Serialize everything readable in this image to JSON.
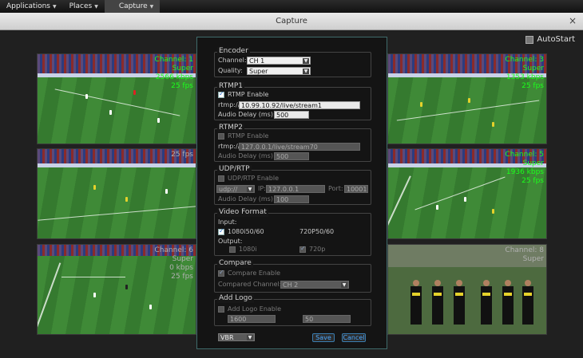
{
  "topbar": {
    "applications": "Applications",
    "places": "Places",
    "capture": "Capture"
  },
  "window": {
    "title": "Capture",
    "close": "×"
  },
  "autostart": {
    "label": "AutoStart"
  },
  "tiles": [
    {
      "lines": [
        "Channel: 1",
        "Super",
        "2566 kbps",
        "25 fps"
      ]
    },
    {
      "lines": [
        "Channel: 3",
        "Super",
        "1353 kbps",
        "25 fps"
      ]
    },
    {
      "lines": [
        "",
        "",
        "",
        "25 fps"
      ]
    },
    {
      "lines": [
        "Channel: 5",
        "Super",
        "1936 kbps",
        "25 fps"
      ]
    },
    {
      "lines": [
        "Channel: 6",
        "Super",
        "0 kbps",
        "25 fps"
      ]
    },
    {
      "lines": [
        "Channel: 8",
        "Super",
        "",
        ""
      ]
    }
  ],
  "dialog": {
    "encoder": {
      "title": "Encoder",
      "channel_label": "Channel:",
      "channel_value": "CH 1",
      "quality_label": "Quality:",
      "quality_value": "Super"
    },
    "rtmp1": {
      "title": "RTMP1",
      "enable_label": "RTMP Enable",
      "url_label": "rtmp://",
      "url_value": "10.99.10.92/live/stream1",
      "delay_label": "Audio Delay (ms):",
      "delay_value": "500"
    },
    "rtmp2": {
      "title": "RTMP2",
      "enable_label": "RTMP Enable",
      "url_label": "rtmp://",
      "url_value": "127.0.0.1/live/stream70",
      "delay_label": "Audio Delay (ms):",
      "delay_value": "500"
    },
    "udp": {
      "title": "UDP/RTP",
      "enable_label": "UDP/RTP Enable",
      "proto_value": "udp://",
      "ip_label": "IP:",
      "ip_value": "127.0.0.1",
      "port_label": "Port:",
      "port_value": "10001",
      "delay_label": "Audio Delay (ms):",
      "delay_value": "100"
    },
    "video": {
      "title": "Video Format",
      "input_label": "Input:",
      "in1": "1080i50/60",
      "in2": "720P50/60",
      "output_label": "Output:",
      "out1": "1080i",
      "out2": "720p"
    },
    "compare": {
      "title": "Compare",
      "enable_label": "Compare Enable",
      "channel_label": "Compared Channel:",
      "channel_value": "CH 2"
    },
    "logo": {
      "title": "Add Logo",
      "enable_label": "Add Logo Enable",
      "x_value": "1600",
      "y_value": "50"
    },
    "rate_mode": "VBR",
    "save": "Save",
    "cancel": "Cancel"
  }
}
